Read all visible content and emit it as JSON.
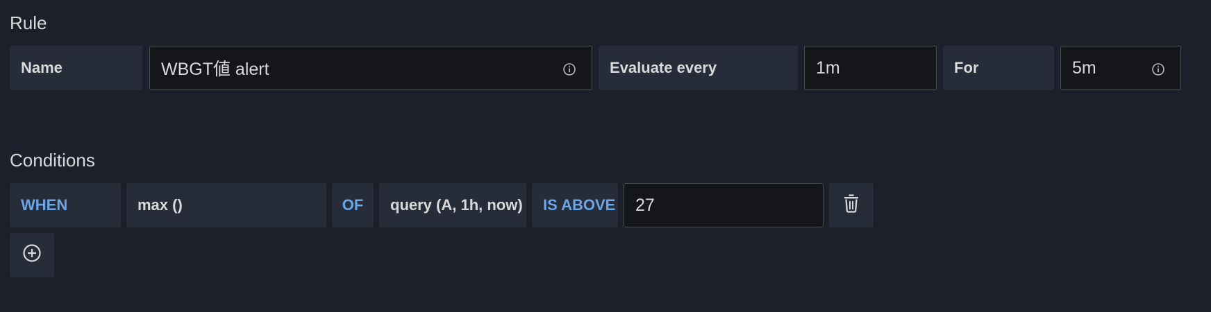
{
  "rule": {
    "heading": "Rule",
    "name_label": "Name",
    "name_value": "WBGT値 alert",
    "evaluate_label": "Evaluate every",
    "evaluate_value": "1m",
    "for_label": "For",
    "for_value": "5m"
  },
  "conditions": {
    "heading": "Conditions",
    "when_label": "WHEN",
    "reducer": "max ()",
    "of_label": "OF",
    "query": "query (A, 1h, now)",
    "evaluator": "IS ABOVE",
    "threshold": "27"
  },
  "icons": {
    "name_info": "info-circle-icon",
    "for_info": "info-circle-icon",
    "delete": "trash-icon",
    "add": "plus-circle-icon"
  },
  "colors": {
    "background": "#1b202a",
    "keyword": "#6aa6e8",
    "label_bg": "#262c38",
    "input_bg": "#141619"
  }
}
